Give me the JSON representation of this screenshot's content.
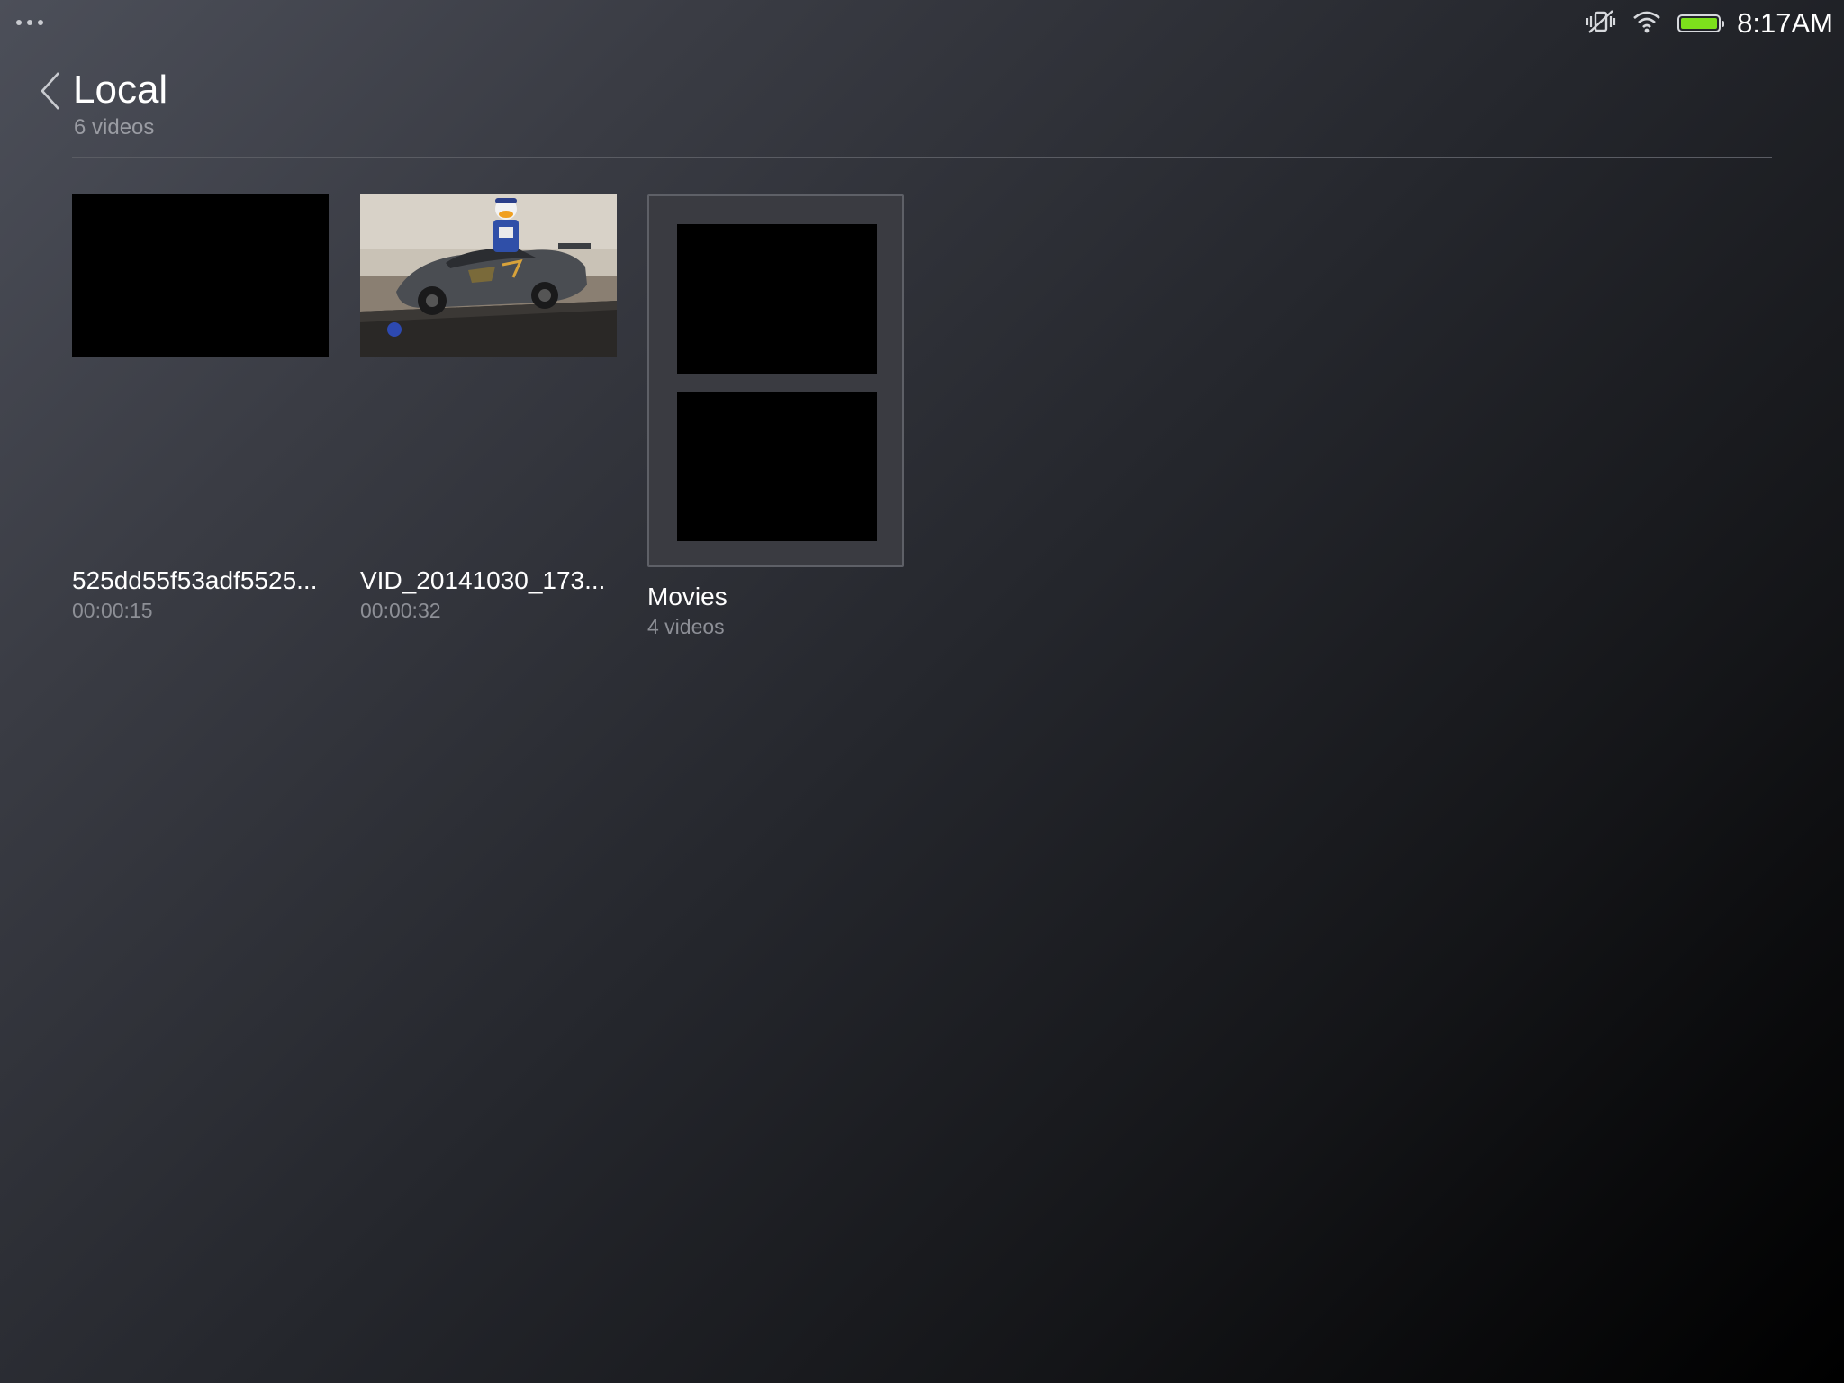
{
  "status_bar": {
    "menu_icon": "more-dots-icon",
    "icons": [
      "vibrate-off-icon",
      "wifi-icon",
      "battery-icon"
    ],
    "battery_color": "#7de01c",
    "time": "8:17AM"
  },
  "header": {
    "back_icon": "chevron-left-icon",
    "title": "Local",
    "subtitle": "6 videos"
  },
  "items": [
    {
      "type": "video",
      "title": "525dd55f53adf5525...",
      "duration": "00:00:15"
    },
    {
      "type": "video",
      "title": "VID_20141030_173...",
      "duration": "00:00:32"
    },
    {
      "type": "folder",
      "title": "Movies",
      "count": "4 videos"
    }
  ]
}
